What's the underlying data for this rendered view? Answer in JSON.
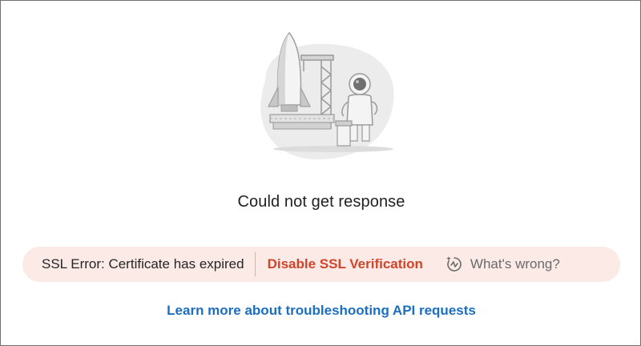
{
  "empty_state": {
    "message": "Could not get response"
  },
  "error_banner": {
    "error_text": "SSL Error: Certificate has expired",
    "action_label": "Disable SSL Verification",
    "action_color": "#d0452b",
    "help_label": "What's wrong?",
    "help_icon": "ai-assistant-icon",
    "background_color": "#fbeae6"
  },
  "footer": {
    "link_text": "Learn more about troubleshooting API requests",
    "link_color": "#1c6ec0"
  },
  "illustration": {
    "icon": "rocket-launch-astronaut-illustration"
  }
}
